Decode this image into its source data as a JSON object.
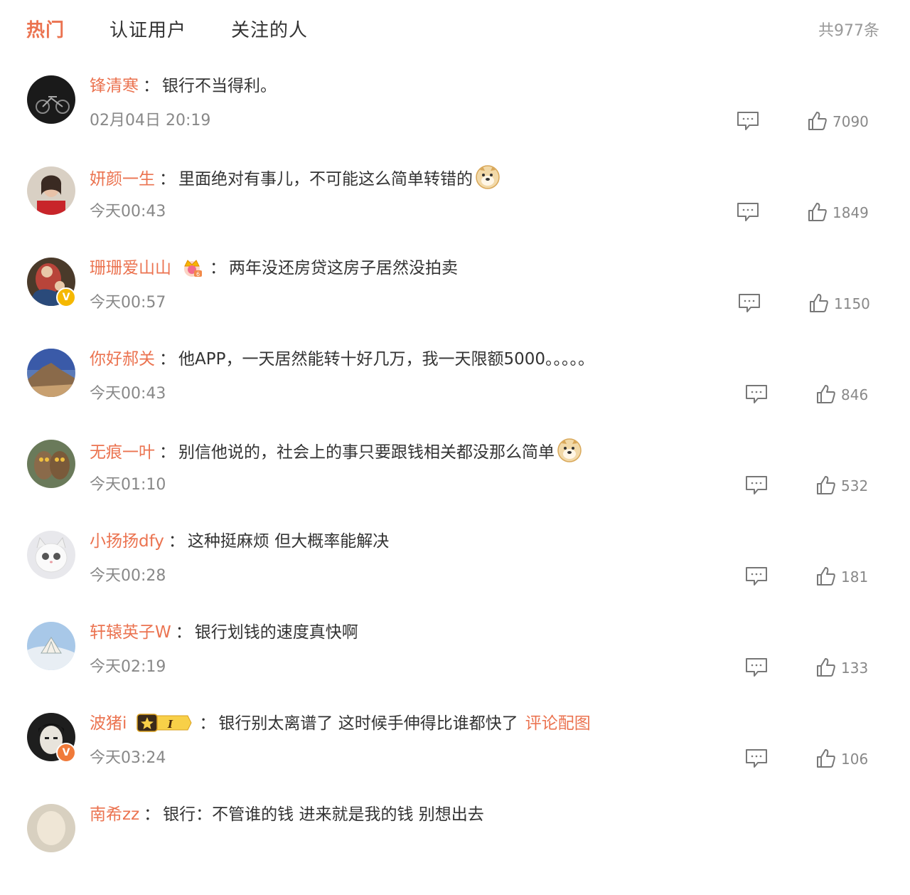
{
  "tabs": [
    {
      "label": "热门",
      "active": true
    },
    {
      "label": "认证用户",
      "active": false
    },
    {
      "label": "关注的人",
      "active": false
    }
  ],
  "total": "共977条",
  "accent_color": "#eb7350",
  "comments": [
    {
      "user": "锋清寒",
      "text": "银行不当得利。",
      "time": "02月04日 20:19",
      "likes": "7090"
    },
    {
      "user": "妍颜一生",
      "text": "里面绝对有事儿，不可能这么简单转错的",
      "time": "今天00:43",
      "likes": "1849",
      "emoji": "doge-emoji"
    },
    {
      "user": "珊珊爱山山",
      "text": "两年没还房贷这房子居然没拍卖",
      "time": "今天00:57",
      "likes": "1150",
      "badge": "verified-yellow",
      "medal": "crown-medal"
    },
    {
      "user": "你好郝关",
      "text": "他APP，一天居然能转十好几万，我一天限额5000。。。。。",
      "time": "今天00:43",
      "likes": "846"
    },
    {
      "user": "无痕一叶",
      "text": "别信他说的，社会上的事只要跟钱相关都没那么简单",
      "time": "今天01:10",
      "likes": "532",
      "emoji": "doge-emoji"
    },
    {
      "user": "小扬扬dfy",
      "text": "这种挺麻烦 但大概率能解决",
      "time": "今天00:28",
      "likes": "181"
    },
    {
      "user": "轩辕英子W",
      "text": "银行划钱的速度真快啊",
      "time": "今天02:19",
      "likes": "133"
    },
    {
      "user": "波猪i",
      "text": "银行别太离谱了 这时候手伸得比谁都快了",
      "time": "今天03:24",
      "likes": "106",
      "badge": "verified-orange",
      "medal": "fan-medal",
      "medal_level": "I",
      "extra": "评论配图"
    },
    {
      "user": "南希zz",
      "text": "银行：不管谁的钱 进来就是我的钱 别想出去",
      "time": "",
      "likes": ""
    }
  ]
}
